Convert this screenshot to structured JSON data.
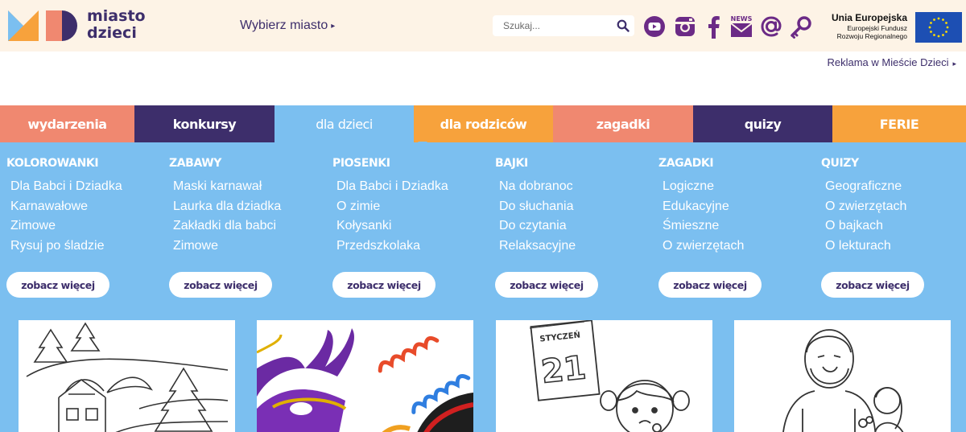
{
  "header": {
    "logo_line1": "miasto",
    "logo_line2": "dzieci",
    "city_select_label": "Wybierz miasto",
    "search_placeholder": "Szukaj...",
    "social_icons": [
      "youtube-icon",
      "instagram-icon",
      "facebook-icon",
      "newsletter-icon",
      "email-icon",
      "login-key-icon"
    ],
    "newsletter_badge": "NEWS",
    "eu_title": "Unia Europejska",
    "eu_line2": "Europejski Fundusz",
    "eu_line3": "Rozwoju Regionalnego"
  },
  "ad_link": "Reklama w Mieście Dzieci",
  "nav": {
    "items": [
      {
        "label": "wydarzenia",
        "color": "#f08870"
      },
      {
        "label": "konkursy",
        "color": "#3d2e6b"
      },
      {
        "label": "dla dzieci",
        "color": "#7bbff0",
        "active": true
      },
      {
        "label": "dla rodziców",
        "color": "#f7a23c"
      },
      {
        "label": "zagadki",
        "color": "#f08870"
      },
      {
        "label": "quizy",
        "color": "#3d2e6b"
      },
      {
        "label": "FERIE",
        "color": "#f7a23c"
      }
    ]
  },
  "menu": {
    "columns": [
      {
        "title": "KOLOROWANKI",
        "links": [
          "Dla Babci i Dziadka",
          "Karnawałowe",
          "Zimowe",
          "Rysuj po śladzie"
        ],
        "button": "zobacz więcej"
      },
      {
        "title": "ZABAWY",
        "links": [
          "Maski karnawał",
          "Laurka dla dziadka",
          "Zakładki dla babci",
          "Zimowe"
        ],
        "button": "zobacz więcej"
      },
      {
        "title": "PIOSENKI",
        "links": [
          "Dla Babci i Dziadka",
          "O zimie",
          "Kołysanki",
          "Przedszkolaka"
        ],
        "button": "zobacz więcej"
      },
      {
        "title": "BAJKI",
        "links": [
          "Na dobranoc",
          "Do słuchania",
          "Do czytania",
          "Relaksacyjne"
        ],
        "button": "zobacz więcej"
      },
      {
        "title": "ZAGADKI",
        "links": [
          "Logiczne",
          "Edukacyjne",
          "Śmieszne",
          "O zwierzętach"
        ],
        "button": "zobacz więcej"
      },
      {
        "title": "QUIZY",
        "links": [
          "Geograficzne",
          "O zwierzętach",
          "O bajkach",
          "O lekturach"
        ],
        "button": "zobacz więcej"
      }
    ]
  },
  "cards": {
    "calendar_month": "STYCZEŃ",
    "calendar_day": "21"
  },
  "colors": {
    "header_bg": "#fdf3e6",
    "brand_dark": "#3d2e6b",
    "menu_bg": "#7bbff0",
    "icon_purple": "#6b2a86"
  }
}
